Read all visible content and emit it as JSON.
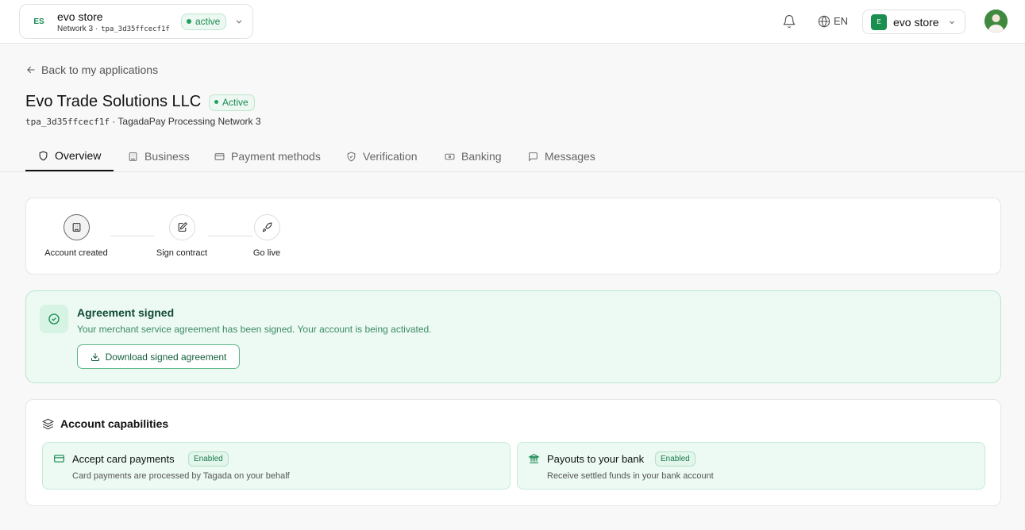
{
  "topbar": {
    "store_initials": "ES",
    "store_name": "evo store",
    "store_network": "Network 3",
    "store_id": "tpa_3d35ffcecf1f",
    "store_status": "active",
    "language": "EN",
    "account_initial": "E",
    "account_name": "evo store"
  },
  "header": {
    "back_label": "Back to my applications",
    "title": "Evo Trade Solutions LLC",
    "status": "Active",
    "app_id": "tpa_3d35ffcecf1f",
    "network_suffix": " · TagadaPay Processing Network 3"
  },
  "tabs": [
    {
      "label": "Overview",
      "icon": "shield-icon",
      "active": true
    },
    {
      "label": "Business",
      "icon": "building-icon",
      "active": false
    },
    {
      "label": "Payment methods",
      "icon": "card-icon",
      "active": false
    },
    {
      "label": "Verification",
      "icon": "shield-check-icon",
      "active": false
    },
    {
      "label": "Banking",
      "icon": "banknote-icon",
      "active": false
    },
    {
      "label": "Messages",
      "icon": "message-icon",
      "active": false
    }
  ],
  "progress": {
    "steps": [
      {
        "label": "Account created",
        "icon": "building-icon",
        "done": true
      },
      {
        "label": "Sign contract",
        "icon": "pen-document-icon",
        "done": false
      },
      {
        "label": "Go live",
        "icon": "rocket-icon",
        "done": false
      }
    ]
  },
  "agreement": {
    "title": "Agreement signed",
    "description": "Your merchant service agreement has been signed. Your account is being activated.",
    "button_label": "Download signed agreement"
  },
  "capabilities": {
    "title": "Account capabilities",
    "items": [
      {
        "title": "Accept card payments",
        "status": "Enabled",
        "description": "Card payments are processed by Tagada on your behalf",
        "icon": "card-icon"
      },
      {
        "title": "Payouts to your bank",
        "status": "Enabled",
        "description": "Receive settled funds in your bank account",
        "icon": "bank-icon"
      }
    ]
  },
  "colors": {
    "accent_green": "#1b8a52",
    "success_bg": "#ecfaf3",
    "success_border": "#b9e6cd"
  }
}
